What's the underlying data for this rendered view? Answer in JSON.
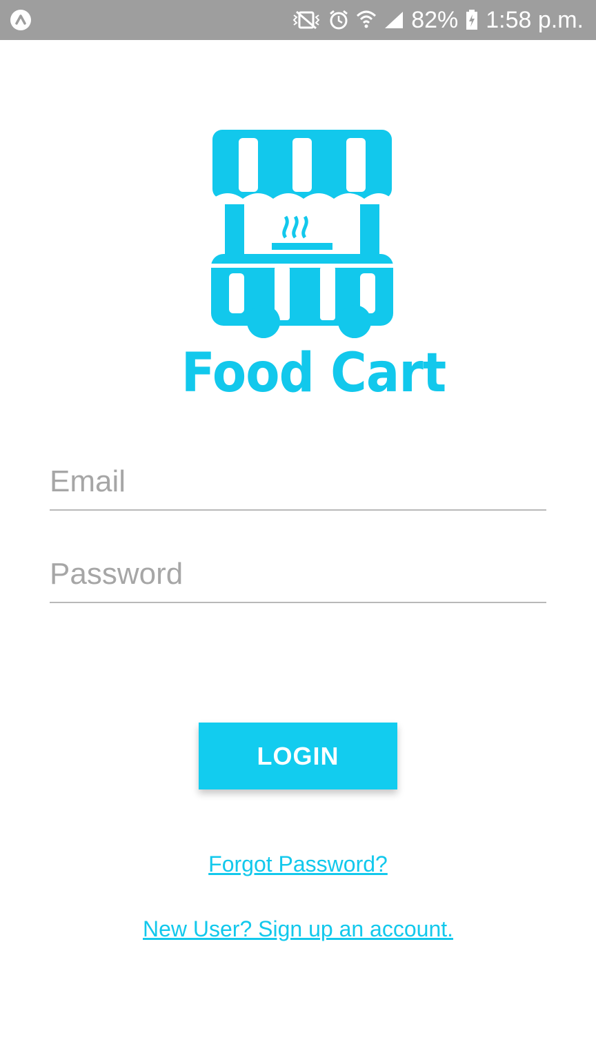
{
  "status_bar": {
    "left_icon": "caret-up-icon",
    "icons": [
      "vibrate-mute-icon",
      "alarm-icon",
      "wifi-icon",
      "signal-icon"
    ],
    "battery_text": "82%",
    "battery_icon": "battery-charging-icon",
    "time": "1:58 p.m."
  },
  "logo": {
    "icon": "food-cart-icon",
    "text": "Food Cart"
  },
  "form": {
    "email_placeholder": "Email",
    "email_value": "",
    "password_placeholder": "Password",
    "password_value": ""
  },
  "actions": {
    "login_label": "LOGIN",
    "forgot_label": "Forgot Password?",
    "signup_label": "New User? Sign up an account."
  },
  "colors": {
    "accent": "#12ccef",
    "status_bar": "#9e9e9e",
    "underline": "#b8b8b8",
    "placeholder": "#a6a6a6"
  }
}
